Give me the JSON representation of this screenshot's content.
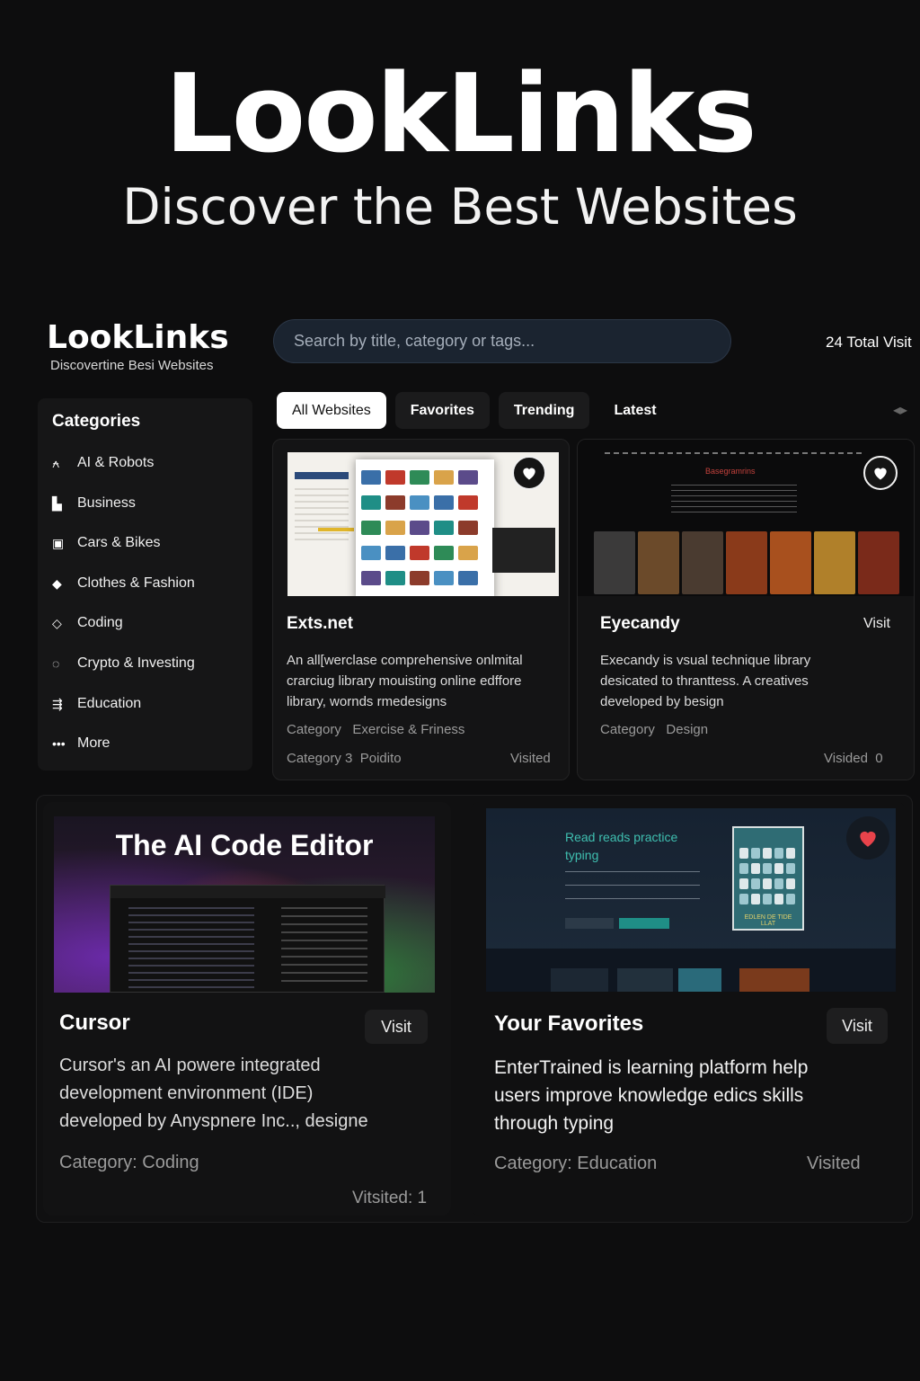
{
  "hero": {
    "title": "LookLinks",
    "subtitle": "Discover the Best Websites"
  },
  "brand": {
    "name": "LookLinks",
    "tagline": "Discovertine Besi Websites"
  },
  "search": {
    "placeholder": "Search by title, category or tags..."
  },
  "stats": {
    "total_visits": "24 Total Visit"
  },
  "sidebar": {
    "heading": "Categories",
    "items": [
      {
        "label": "AI & Robots",
        "icon": "robot-icon"
      },
      {
        "label": "Business",
        "icon": "briefcase-icon"
      },
      {
        "label": "Cars & Bikes",
        "icon": "car-icon"
      },
      {
        "label": "Clothes & Fashion",
        "icon": "shirt-icon"
      },
      {
        "label": "Coding",
        "icon": "diamond-icon"
      },
      {
        "label": "Crypto & Investing",
        "icon": "coin-icon"
      },
      {
        "label": "Education",
        "icon": "graduation-icon"
      },
      {
        "label": "More",
        "icon": "more-icon"
      }
    ]
  },
  "tabs": [
    {
      "label": "All Websites",
      "active": true
    },
    {
      "label": "Favorites",
      "active": false
    },
    {
      "label": "Trending",
      "active": false
    },
    {
      "label": "Latest",
      "active": false
    }
  ],
  "cards": [
    {
      "title": "Exts.net",
      "description": "An all[werclase comprehensive onlmital crarciug library mouisting online edffore library, wornds rmedesigns",
      "category_label": "Category",
      "category": "Exercise & Friness",
      "category2_label": "Category 3",
      "category2": "Poidito",
      "visited_label": "Visited",
      "favorite": false
    },
    {
      "title": "Eyecandy",
      "visit_label": "Visit",
      "description": "Execandy is vsual technique library desicated to thranttess. A creatives developed by besign",
      "category_label": "Category",
      "category": "Design",
      "visited_label": "Visided",
      "visited_count": "0",
      "thumb_text": "Basegramrins",
      "favorite": false
    },
    {
      "title": "Cursor",
      "visit_label": "Visit",
      "description": "Cursor's an AI powere integrated development environment (IDE) developed by Anyspnere Inc.., designe",
      "category_text": "Category:  Coding",
      "visited_text": "Vitsited: 1",
      "thumb_title": "The AI Code Editor"
    },
    {
      "title": "Your Favorites",
      "visit_label": "Visit",
      "description": "EnterTrained is learning platform help users improve knowledge edics skills through typing",
      "category_text": "Category: Education",
      "visited_label": "Visited",
      "thumb_heading": "Read reads practice typing",
      "thumb_book": "EDLEN DE TIDE LLAT",
      "favorite": true
    }
  ],
  "colors": {
    "background": "#0d0d0e",
    "card": "#141415",
    "search_bg": "#1b2430",
    "heart_red": "#e8434b",
    "teal": "#1f8e86"
  }
}
